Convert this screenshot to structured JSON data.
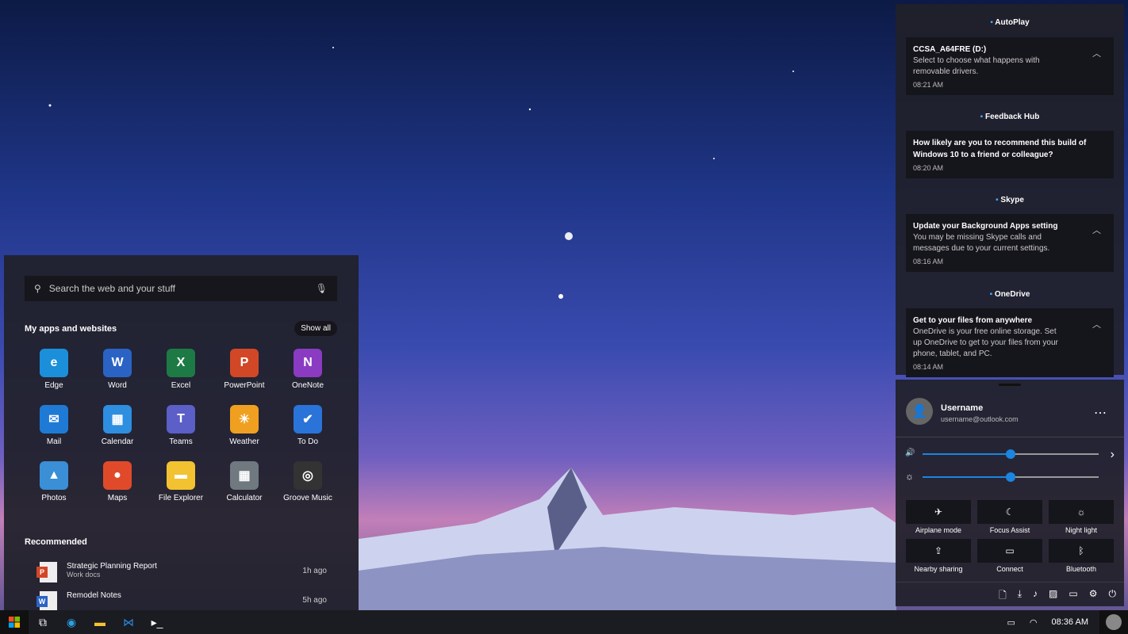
{
  "start": {
    "search_placeholder": "Search the web and your stuff",
    "apps_title": "My apps and websites",
    "show_all": "Show all",
    "apps": [
      {
        "label": "Edge",
        "color": "#1b8fd9",
        "glyph": "e"
      },
      {
        "label": "Word",
        "color": "#2b63c5",
        "glyph": "W"
      },
      {
        "label": "Excel",
        "color": "#1d7a45",
        "glyph": "X"
      },
      {
        "label": "PowerPoint",
        "color": "#d24726",
        "glyph": "P"
      },
      {
        "label": "OneNote",
        "color": "#8a3bc2",
        "glyph": "N"
      },
      {
        "label": "Mail",
        "color": "#1f7ad6",
        "glyph": "✉"
      },
      {
        "label": "Calendar",
        "color": "#2e8ee0",
        "glyph": "▦"
      },
      {
        "label": "Teams",
        "color": "#5b5fc7",
        "glyph": "T"
      },
      {
        "label": "Weather",
        "color": "#f0a020",
        "glyph": "☀"
      },
      {
        "label": "To Do",
        "color": "#2a73d8",
        "glyph": "✔"
      },
      {
        "label": "Photos",
        "color": "#3a8fd6",
        "glyph": "▲"
      },
      {
        "label": "Maps",
        "color": "#e04a2a",
        "glyph": "●"
      },
      {
        "label": "File Explorer",
        "color": "#f2c230",
        "glyph": "▬"
      },
      {
        "label": "Calculator",
        "color": "#707880",
        "glyph": "▦"
      },
      {
        "label": "Groove Music",
        "color": "#333",
        "glyph": "◎"
      }
    ],
    "recommended_title": "Recommended",
    "recommended": [
      {
        "title": "Strategic Planning Report",
        "sub": "Work docs",
        "ago": "1h ago",
        "type": "P",
        "color": "#d24726"
      },
      {
        "title": "Remodel Notes",
        "sub": "",
        "ago": "5h ago",
        "type": "W",
        "color": "#2b63c5"
      }
    ]
  },
  "notifications": [
    {
      "app": "AutoPlay",
      "title": "CCSA_A64FRE (D:)",
      "body": "Select to choose what happens with removable drivers.",
      "time": "08:21 AM",
      "expand": true
    },
    {
      "app": "Feedback Hub",
      "title": "How likely are you to recommend this build of Windows 10 to a friend or colleague?",
      "body": "",
      "time": "08:20 AM",
      "expand": false
    },
    {
      "app": "Skype",
      "title": "Update your Background Apps setting",
      "body": "You may be missing Skype calls and messages due to your current settings.",
      "time": "08:16 AM",
      "expand": true
    },
    {
      "app": "OneDrive",
      "title": "Get to your files from anywhere",
      "body": "OneDrive is your free online storage. Set up OneDrive to get to your files from your phone, tablet, and PC.",
      "time": "08:14 AM",
      "expand": true
    }
  ],
  "quick": {
    "username": "Username",
    "email": "username@outlook.com",
    "volume": 50,
    "brightness": 50,
    "tiles": [
      "Airplane mode",
      "Focus Assist",
      "Night light",
      "Nearby sharing",
      "Connect",
      "Bluetooth"
    ],
    "tile_icons": [
      "✈",
      "☾",
      "☼",
      "⇪",
      "▭",
      "ᛒ"
    ]
  },
  "taskbar": {
    "time": "08:36 AM"
  }
}
